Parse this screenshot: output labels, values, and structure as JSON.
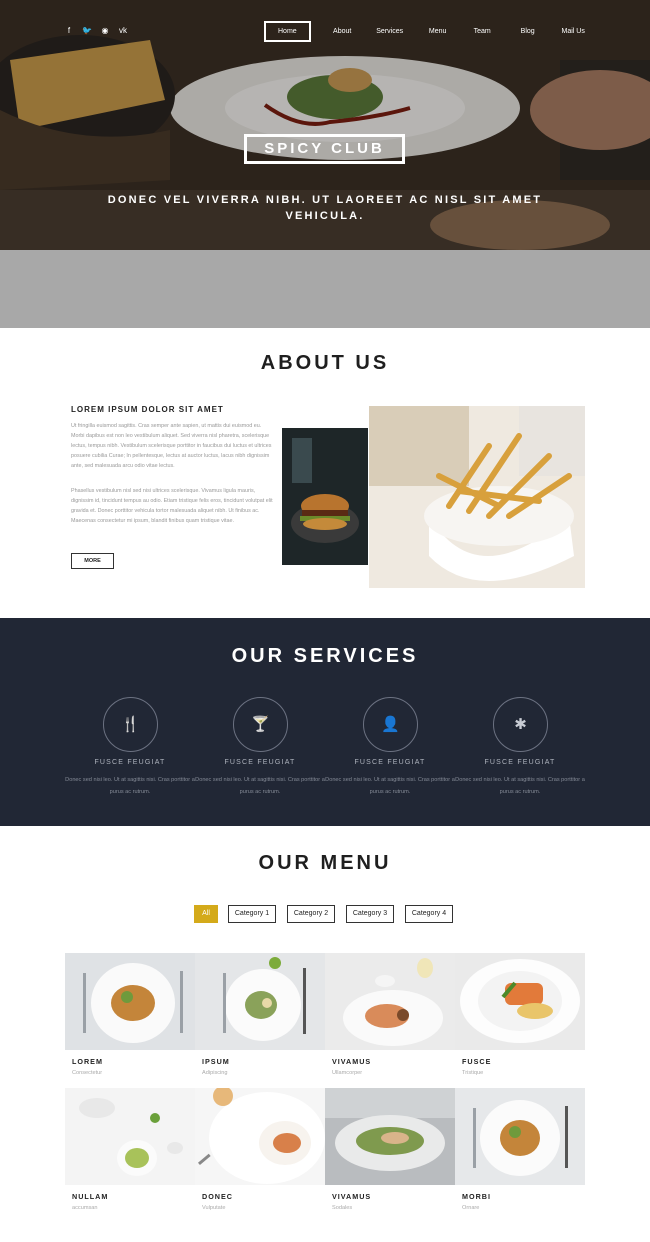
{
  "social": [
    "f",
    "t",
    "rss",
    "vk"
  ],
  "nav": {
    "items": [
      "Home",
      "About",
      "Services",
      "Menu",
      "Team",
      "Blog",
      "Mail Us"
    ]
  },
  "hero": {
    "brand": "SPICY CLUB",
    "tagline": "DONEC VEL VIVERRA NIBH. UT LAOREET AC NISL SIT AMET VEHICULA."
  },
  "about": {
    "title": "ABOUT US",
    "subtitle": "LOREM IPSUM DOLOR SIT AMET",
    "para1": "Ut fringilla euismod sagittis. Cras semper ante sapien, ut mattis dui euismod eu. Morbi dapibus est non leo vestibulum aliquet. Sed viverra nisl pharetra, scelerisque lectus, tempus nibh. Vestibulum scelerisque porttitor in faucibus dui luctus et ultrices posuere cubilia Curae; In pellentesque, lectus at auctor luctus, lacus nibh dignissim ante, sed malesuada arcu odio vitae lectus.",
    "para2": "Phasellus vestibulum nisl sed nisi ultrices scelerisque. Vivamus ligula mauris, dignissim id, tincidunt tempus au odio. Etiam tristique felis eros, tincidunt volutpat elit gravida et. Donec porttitor vehicula tortor malesuada aliquet nibh. Ut finibus ac. Maecenas consectetur mi ipsum, blandit finibus quam tristique vitae.",
    "more": "MORE"
  },
  "services": {
    "title": "OUR SERVICES",
    "items": [
      {
        "icon": "cutlery-icon",
        "glyph": "🍴",
        "title": "FUSCE FEUGIAT",
        "desc": "Donec sed nisi leo. Ut at sagittis nisi. Cras porttitor a purus ac rutrum."
      },
      {
        "icon": "cocktail-icon",
        "glyph": "🍸",
        "title": "FUSCE FEUGIAT",
        "desc": "Donec sed nisi leo. Ut at sagittis nisi. Cras porttitor a purus ac rutrum."
      },
      {
        "icon": "user-icon",
        "glyph": "👤",
        "title": "FUSCE FEUGIAT",
        "desc": "Donec sed nisi leo. Ut at sagittis nisi. Cras porttitor a purus ac rutrum."
      },
      {
        "icon": "asterisk-icon",
        "glyph": "✱",
        "title": "FUSCE FEUGIAT",
        "desc": "Donec sed nisi leo. Ut at sagittis nisi. Cras porttitor a purus ac rutrum."
      }
    ]
  },
  "menu": {
    "title": "OUR MENU",
    "filters": [
      "All",
      "Category 1",
      "Category 2",
      "Category 3",
      "Category 4"
    ],
    "dishes": [
      {
        "name": "LOREM",
        "sub": "Consectetur"
      },
      {
        "name": "IPSUM",
        "sub": "Adipiscing"
      },
      {
        "name": "VIVAMUS",
        "sub": "Ullamcorper"
      },
      {
        "name": "FUSCE",
        "sub": "Tristique"
      },
      {
        "name": "NULLAM",
        "sub": "accumsan"
      },
      {
        "name": "DONEC",
        "sub": "Vulputate"
      },
      {
        "name": "VIVAMUS",
        "sub": "Sodales"
      },
      {
        "name": "MORBI",
        "sub": "Ornare"
      }
    ]
  },
  "colors": {
    "accent": "#d4aa1a",
    "services_bg": "#212735",
    "hero_band": "#a8a8a8"
  }
}
